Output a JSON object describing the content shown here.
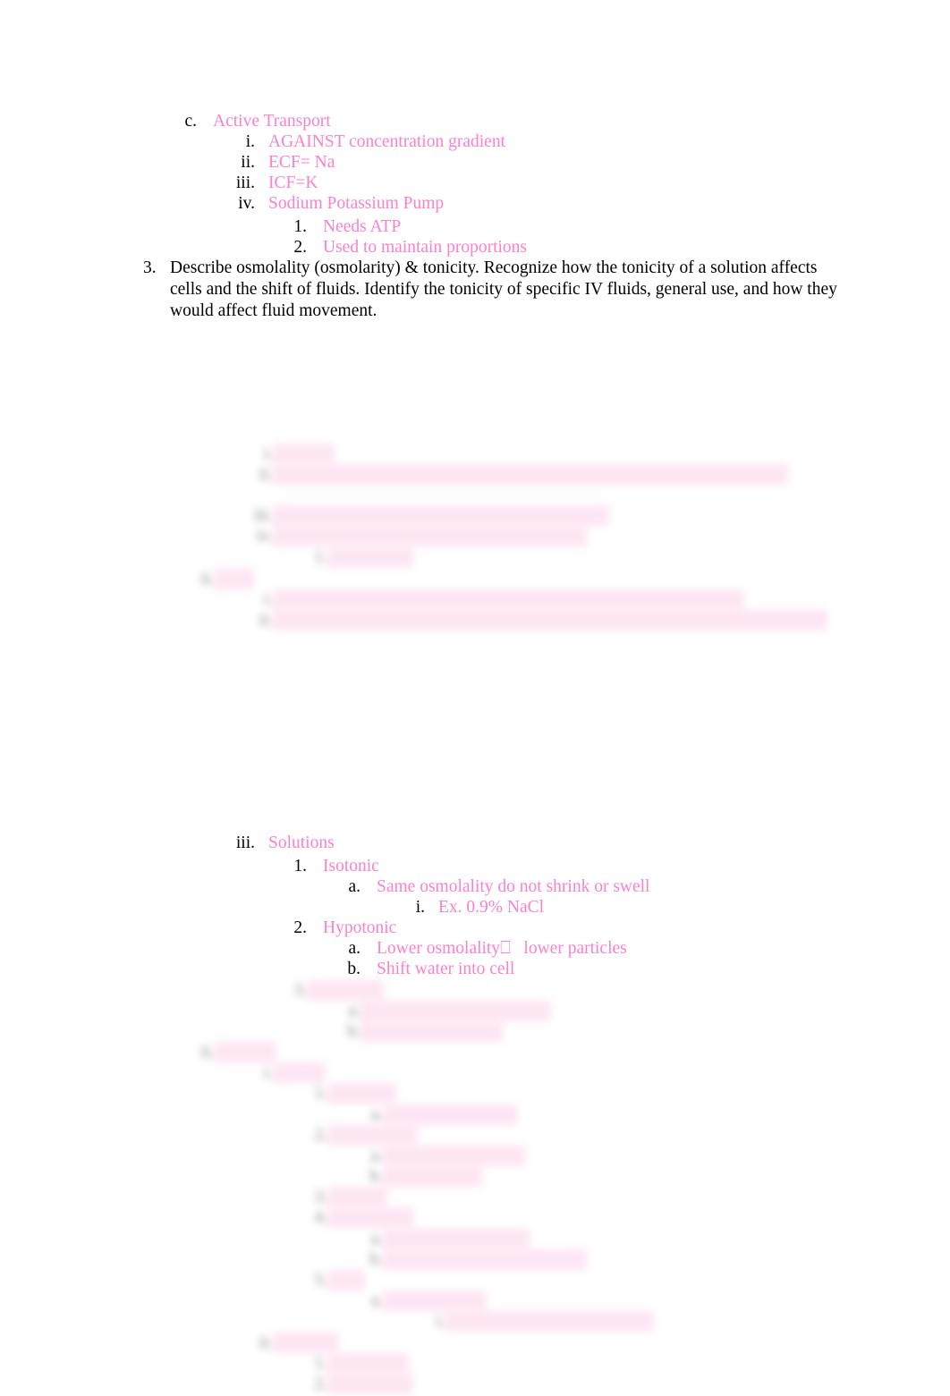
{
  "document": {
    "type": "study-guide-outline",
    "text_color_accent": "#fb82c8",
    "text_color_default": "#000000",
    "page_background": "#ffffff"
  },
  "outline": {
    "active_transport": {
      "marker": "c.",
      "label": "Active Transport",
      "children": [
        {
          "marker": "i.",
          "label": "AGAINST concentration gradient"
        },
        {
          "marker": "ii.",
          "label": "ECF= Na"
        },
        {
          "marker": "iii.",
          "label": "ICF=K"
        },
        {
          "marker": "iv.",
          "label": "Sodium Potassium Pump",
          "children": [
            {
              "marker": "1.",
              "label": "Needs ATP"
            },
            {
              "marker": "2.",
              "label": "Used to maintain proportions"
            }
          ]
        }
      ]
    },
    "objective_3": {
      "marker": "3.",
      "text": "Describe osmolality (osmolarity) & tonicity. Recognize how the tonicity of a solution affects cells and the shift of fluids. Identify the tonicity of specific IV fluids, general use, and how they would affect fluid movement."
    },
    "solutions": {
      "marker": "iii.",
      "label": "Solutions",
      "children": [
        {
          "marker": "1.",
          "label": "Isotonic",
          "children": [
            {
              "marker": "a.",
              "label": "Same osmolality do not shrink or swell",
              "children": [
                {
                  "marker": "i.",
                  "label": "Ex. 0.9% NaCl"
                }
              ]
            }
          ]
        },
        {
          "marker": "2.",
          "label": "Hypotonic",
          "children": [
            {
              "marker": "a.",
              "label": "Lower osmolality⎕   lower particles"
            },
            {
              "marker": "b.",
              "label": "Shift water into cell"
            }
          ]
        }
      ]
    }
  },
  "obscured": {
    "note": "Illegible blurred outline text",
    "block_a": [
      {
        "marker": "i.",
        "label": "           "
      },
      {
        "marker": "ii.",
        "label": "                                                                                                                   "
      },
      {
        "marker": "iii.",
        "label": "                                                                          "
      },
      {
        "marker": "iv.",
        "label": "                                                                     "
      },
      {
        "marker": "1.",
        "label": "                "
      }
    ],
    "block_b": [
      {
        "marker": "ii.",
        "label": "      "
      },
      {
        "marker": "i.",
        "label": "                                                                                                         "
      },
      {
        "marker": "ii.",
        "label": "                                                                                                                            "
      }
    ],
    "block_c": [
      {
        "marker": "3.",
        "label": "              "
      },
      {
        "marker": "a.",
        "label": "                                        "
      },
      {
        "marker": "b.",
        "label": "                             "
      }
    ],
    "block_d": [
      {
        "marker": "ii.",
        "label": "           "
      },
      {
        "marker": "i.",
        "label": "         "
      },
      {
        "marker": "1.",
        "label": "            "
      },
      {
        "marker": "a.",
        "label": "                           "
      },
      {
        "marker": "2.",
        "label": "                 "
      },
      {
        "marker": "a.",
        "label": "                             "
      },
      {
        "marker": "b.",
        "label": "                   "
      },
      {
        "marker": "3.",
        "label": "          "
      },
      {
        "marker": "4.",
        "label": "                "
      },
      {
        "marker": "a.",
        "label": "                              "
      },
      {
        "marker": "b.",
        "label": "                                           "
      },
      {
        "marker": "5.",
        "label": "     "
      },
      {
        "marker": "a.",
        "label": "                    "
      },
      {
        "marker": "i.",
        "label": "                                             "
      },
      {
        "marker": "ii.",
        "label": "            "
      },
      {
        "marker": "1.",
        "label": "               "
      },
      {
        "marker": "2.",
        "label": "                "
      }
    ]
  }
}
